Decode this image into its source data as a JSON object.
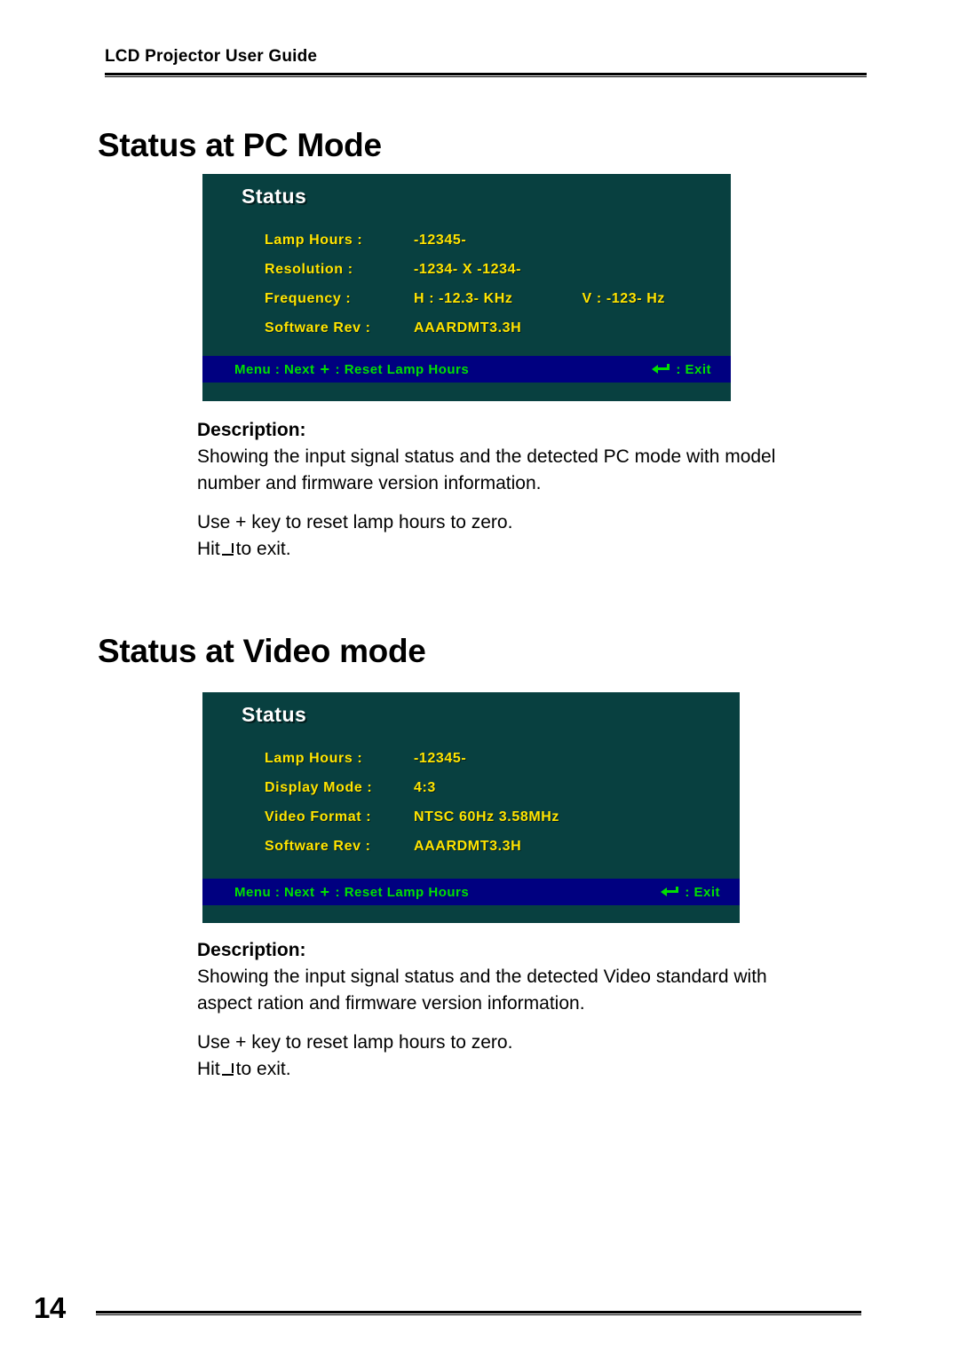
{
  "header": {
    "running_title": "LCD Projector User Guide"
  },
  "sections": [
    {
      "heading": "Status at PC Mode",
      "osd": {
        "title": "Status",
        "rows": [
          {
            "label": "Lamp Hours :",
            "value": "-12345-",
            "value2": ""
          },
          {
            "label": "Resolution :",
            "value": "-1234-  X   -1234-",
            "value2": ""
          },
          {
            "label": "Frequency :",
            "value": "H :   -12.3-  KHz",
            "value2": "V :  -123-  Hz"
          },
          {
            "label": "Software Rev :",
            "value": "AAARDMT3.3H",
            "value2": ""
          }
        ],
        "footer": {
          "menu_label": "Menu : Next",
          "plus_glyph": "+",
          "reset_label": ": Reset Lamp Hours",
          "exit_label": ": Exit",
          "enter_icon": "enter-key-icon"
        },
        "colors": {
          "background": "#084040",
          "footer_bar": "#000080",
          "label_text": "#ffe400",
          "footer_text": "#00e000",
          "title_text": "#ffffff"
        }
      },
      "description": {
        "title": "Description:",
        "paragraph1": "Showing the input signal status and the detected PC mode with model number and firmware version information.",
        "paragraph2": "Use + key to reset lamp hours to zero.",
        "paragraph3_before": "Hit",
        "paragraph3_after": "to exit."
      }
    },
    {
      "heading": "Status at Video mode",
      "osd": {
        "title": "Status",
        "rows": [
          {
            "label": "Lamp Hours :",
            "value": "-12345-",
            "value2": ""
          },
          {
            "label": "Display Mode :",
            "value": "4:3",
            "value2": ""
          },
          {
            "label": "Video Format :",
            "value": "NTSC 60Hz  3.58MHz",
            "value2": ""
          },
          {
            "label": "Software Rev :",
            "value": "AAARDMT3.3H",
            "value2": ""
          }
        ],
        "footer": {
          "menu_label": "Menu : Next",
          "plus_glyph": "+",
          "reset_label": ": Reset Lamp Hours",
          "exit_label": ": Exit",
          "enter_icon": "enter-key-icon"
        },
        "colors": {
          "background": "#084040",
          "footer_bar": "#000080",
          "label_text": "#ffe400",
          "footer_text": "#00e000",
          "title_text": "#ffffff"
        }
      },
      "description": {
        "title": "Description:",
        "paragraph1": "Showing the input signal status and the detected Video standard with aspect ration and firmware version information.",
        "paragraph2": "Use + key to reset lamp hours to zero.",
        "paragraph3_before": "Hit",
        "paragraph3_after": "to exit."
      }
    }
  ],
  "footer": {
    "page_number": "14"
  }
}
